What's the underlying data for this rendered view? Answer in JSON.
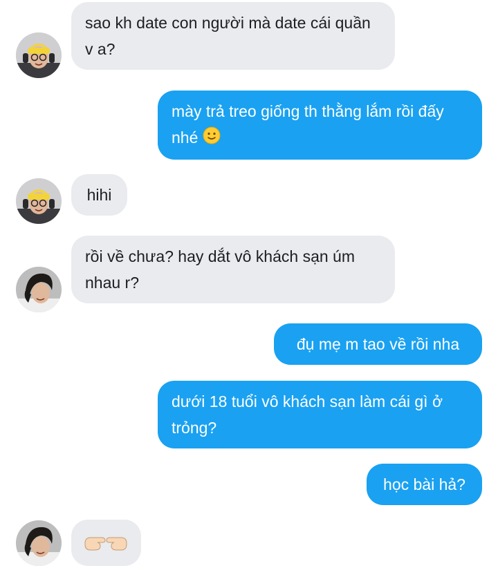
{
  "messages": [
    {
      "id": "m1",
      "side": "in",
      "text": "sao kh date con người mà date cái quần v a?",
      "avatar": "yellow-beanie-headphones-avatar"
    },
    {
      "id": "m2",
      "side": "out",
      "text": "mày trả treo giống th thằng lắm rồi đấy nhé",
      "emoji": "slightly-smiling-face"
    },
    {
      "id": "m3",
      "side": "in",
      "text": "hihi",
      "avatar": "yellow-beanie-headphones-avatar"
    },
    {
      "id": "m4",
      "side": "in",
      "text": "rồi về chưa? hay dắt vô khách sạn úm nhau r?",
      "avatar": "dark-hair-avatar"
    },
    {
      "id": "m5",
      "side": "out",
      "text": "đụ mẹ m tao về rồi nha"
    },
    {
      "id": "m6",
      "side": "out",
      "text": "dưới 18 tuổi vô khách sạn làm cái gì ở trỏng?"
    },
    {
      "id": "m7",
      "side": "out",
      "text": "học bài hả?"
    },
    {
      "id": "m8",
      "side": "in",
      "text": "",
      "emoji": "index-pointing-fingers",
      "avatar": "dark-hair-avatar"
    }
  ],
  "colors": {
    "outgoing_bubble": "#1aa1f1",
    "incoming_bubble": "#e9ebee",
    "incoming_text": "#1c1e21",
    "outgoing_text": "#ffffff"
  }
}
